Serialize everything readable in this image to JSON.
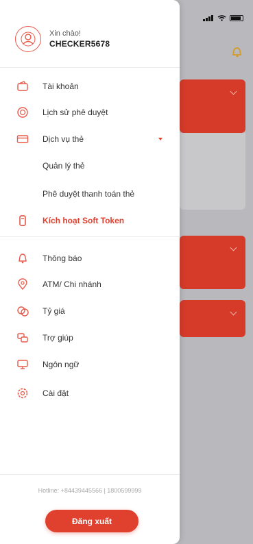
{
  "colors": {
    "accent": "#e0402e",
    "scrim": "#b9b9bd",
    "card": "#d63b2a"
  },
  "profile": {
    "greeting": "Xin chào!",
    "username": "CHECKER5678"
  },
  "menu": {
    "top": [
      {
        "label": "Tài khoản",
        "icon": "wallet-icon"
      },
      {
        "label": "Lịch sử phê duyệt",
        "icon": "history-icon"
      },
      {
        "label": "Dịch vụ thẻ",
        "icon": "card-icon"
      },
      {
        "label": "Quản lý thẻ",
        "icon": ""
      },
      {
        "label": "Phê duyệt thanh toán thẻ",
        "icon": ""
      },
      {
        "label": "Kích hoạt Soft Token",
        "icon": "token-icon"
      }
    ],
    "bottom": [
      {
        "label": "Thông báo",
        "icon": "bell-icon"
      },
      {
        "label": "ATM/ Chi nhánh",
        "icon": "location-icon"
      },
      {
        "label": "Tỷ giá",
        "icon": "exchange-rate-icon"
      },
      {
        "label": "Trợ giúp",
        "icon": "help-icon"
      },
      {
        "label": "Ngôn ngữ",
        "icon": "language-icon"
      },
      {
        "label": "Cài đặt",
        "icon": "settings-icon"
      }
    ]
  },
  "footer": {
    "hotline": "Hotline: +84439445566 | 1800599999",
    "logout_label": "Đăng xuất"
  }
}
